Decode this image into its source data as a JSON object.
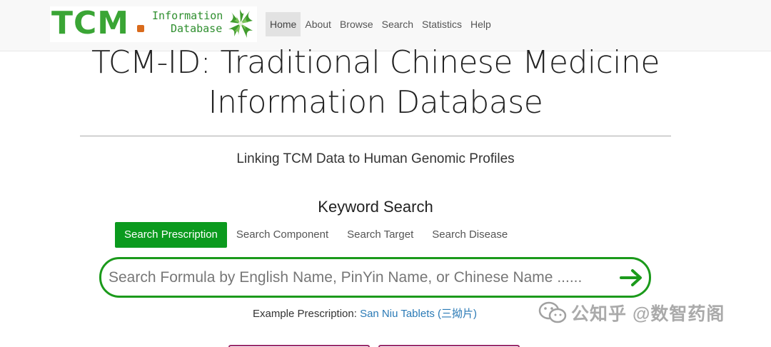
{
  "logo": {
    "text": "TCM",
    "info_line1": "Information",
    "info_line2": "Database"
  },
  "nav": {
    "items": [
      "Home",
      "About",
      "Browse",
      "Search",
      "Statistics",
      "Help"
    ],
    "active": "Home"
  },
  "page_title": "TCM-ID: Traditional Chinese Medicine Information Database",
  "subtitle": "Linking TCM Data to Human Genomic Profiles",
  "keyword_search": {
    "heading": "Keyword Search",
    "tabs": [
      "Search Prescription",
      "Search Component",
      "Search Target",
      "Search Disease"
    ],
    "active_tab": "Search Prescription",
    "placeholder": "Search Formula by English Name, PinYin Name, or Chinese Name ......",
    "value": ""
  },
  "example": {
    "label": "Example Prescription:",
    "link": "San Niu Tablets (三拗片)"
  },
  "watermark": {
    "text": "公知乎 @数智药阁",
    "icon": "wechat-icon"
  },
  "colors": {
    "accent_green": "#0b9a1e",
    "logo_green": "#3aa535",
    "logo_orange": "#d96b1c",
    "link_blue": "#2a7ab6"
  }
}
